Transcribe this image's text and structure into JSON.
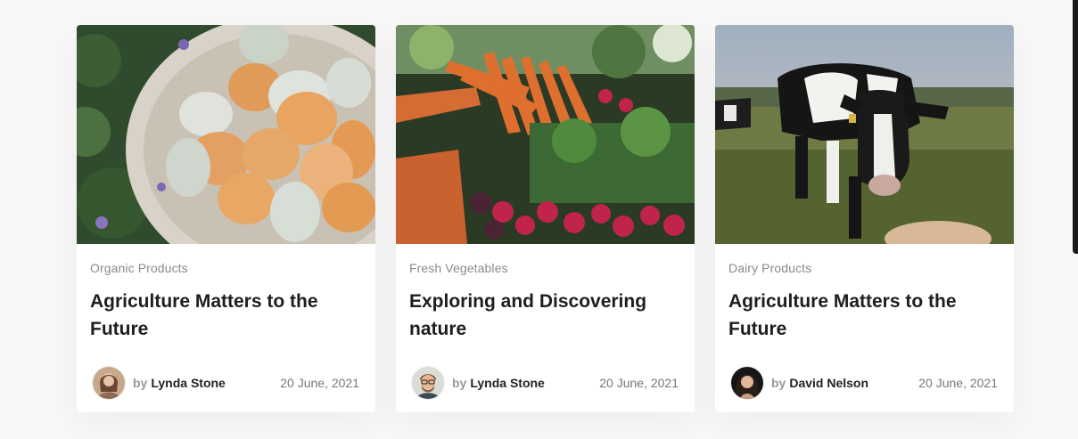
{
  "cards": [
    {
      "category": "Organic Products",
      "title": "Agriculture Matters to the Future",
      "author_prefix": "by",
      "author": "Lynda Stone",
      "date": "20 June, 2021",
      "image": "eggs-in-basket-photo",
      "avatar": "female-avatar"
    },
    {
      "category": "Fresh Vegetables",
      "title": "Exploring and Discovering nature",
      "author_prefix": "by",
      "author": "Lynda Stone",
      "date": "20 June, 2021",
      "image": "carrots-and-radishes-photo",
      "avatar": "male-avatar"
    },
    {
      "category": "Dairy Products",
      "title": "Agriculture Matters to the Future",
      "author_prefix": "by",
      "author": "David Nelson",
      "date": "20 June, 2021",
      "image": "dairy-cow-photo",
      "avatar": "female-avatar"
    }
  ]
}
